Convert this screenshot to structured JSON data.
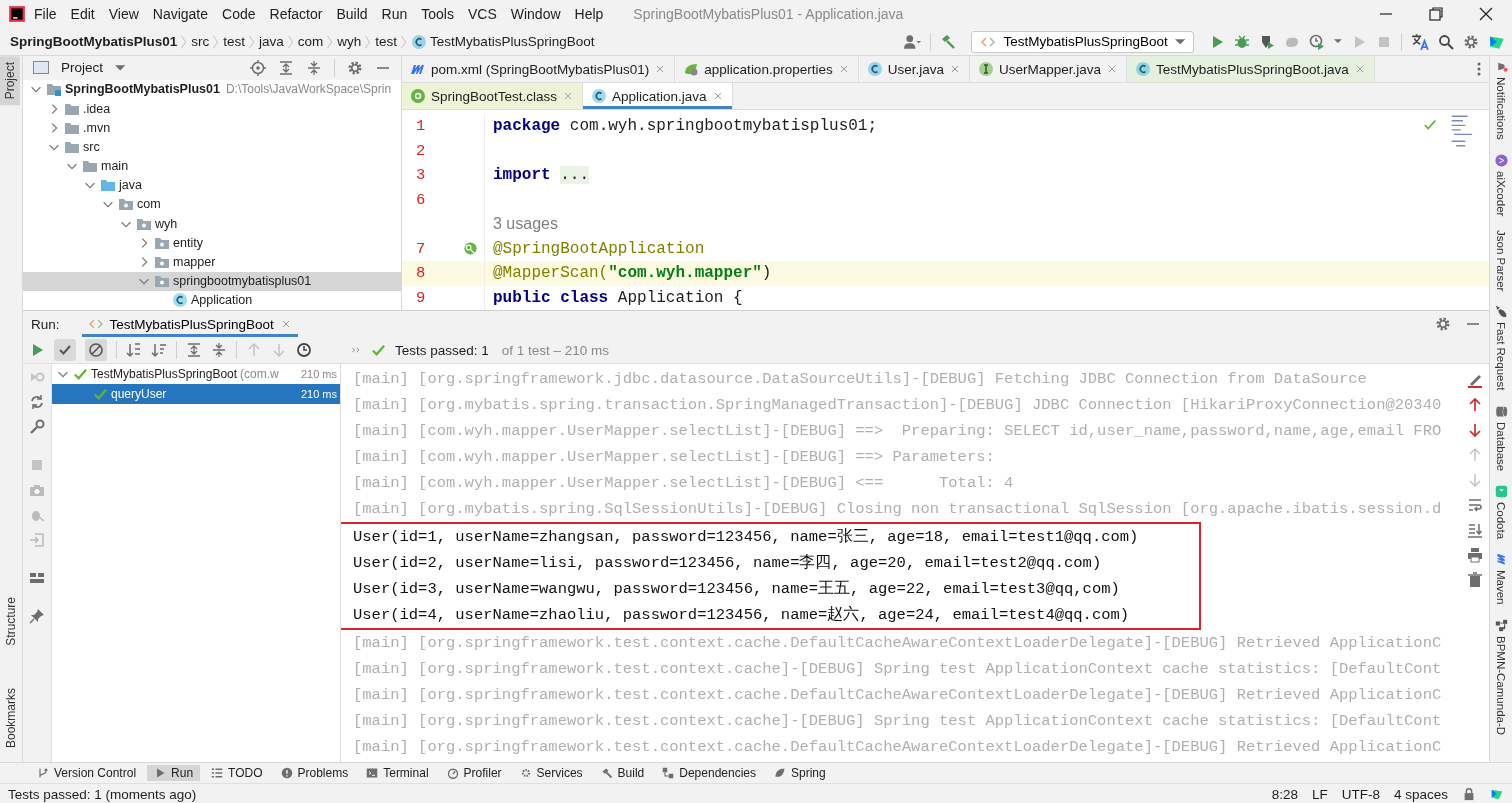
{
  "menu_bar": {
    "items": [
      "File",
      "Edit",
      "View",
      "Navigate",
      "Code",
      "Refactor",
      "Build",
      "Run",
      "Tools",
      "VCS",
      "Window",
      "Help"
    ],
    "title": "SpringBootMybatisPlus01 - Application.java"
  },
  "nav_bar": {
    "breadcrumbs": [
      {
        "label": "SpringBootMybatisPlus01",
        "kind": "project"
      },
      {
        "label": "src",
        "kind": "dir"
      },
      {
        "label": "test",
        "kind": "dir"
      },
      {
        "label": "java",
        "kind": "dir"
      },
      {
        "label": "com",
        "kind": "dir"
      },
      {
        "label": "wyh",
        "kind": "dir"
      },
      {
        "label": "test",
        "kind": "dir"
      },
      {
        "label": "TestMybatisPlusSpringBoot",
        "kind": "class"
      }
    ],
    "run_config": "TestMybatisPlusSpringBoot"
  },
  "left_strip": {
    "top": [
      {
        "label": "Project",
        "selected": true
      }
    ],
    "bottom": [
      {
        "label": "Structure",
        "selected": false
      },
      {
        "label": "Bookmarks",
        "selected": false
      }
    ]
  },
  "project_panel": {
    "title": "Project",
    "tree": [
      {
        "label": "SpringBootMybatisPlus01",
        "path": "D:\\Tools\\JavaWorkSpace\\Sprin",
        "kind": "module",
        "expanded": true,
        "selected": false,
        "children": [
          {
            "label": ".idea",
            "kind": "folder",
            "expanded": false,
            "selected": false
          },
          {
            "label": ".mvn",
            "kind": "folder",
            "expanded": false,
            "selected": false
          },
          {
            "label": "src",
            "kind": "folder",
            "expanded": true,
            "selected": false,
            "children": [
              {
                "label": "main",
                "kind": "folder",
                "expanded": true,
                "selected": false,
                "children": [
                  {
                    "label": "java",
                    "kind": "source",
                    "expanded": true,
                    "selected": false,
                    "children": [
                      {
                        "label": "com",
                        "kind": "package",
                        "expanded": true,
                        "selected": false,
                        "children": [
                          {
                            "label": "wyh",
                            "kind": "package",
                            "expanded": true,
                            "selected": false,
                            "children": [
                              {
                                "label": "entity",
                                "kind": "package",
                                "expanded": false,
                                "selected": false
                              },
                              {
                                "label": "mapper",
                                "kind": "package",
                                "expanded": false,
                                "selected": false
                              },
                              {
                                "label": "springbootmybatisplus01",
                                "kind": "package",
                                "expanded": true,
                                "selected": true,
                                "children": [
                                  {
                                    "label": "Application",
                                    "kind": "file",
                                    "selected": false
                                  }
                                ]
                              }
                            ]
                          }
                        ]
                      }
                    ]
                  }
                ]
              }
            ]
          }
        ]
      }
    ]
  },
  "editor": {
    "tab_rows": [
      [
        {
          "label": "pom.xml (SpringBootMybatisPlus01)",
          "kind": "maven",
          "selected": false
        },
        {
          "label": "application.properties",
          "kind": "properties",
          "selected": false
        },
        {
          "label": "User.java",
          "kind": "class",
          "selected": false
        },
        {
          "label": "UserMapper.java",
          "kind": "interface",
          "selected": false
        },
        {
          "label": "TestMybatisPlusSpringBoot.java",
          "kind": "test",
          "selected": false
        }
      ],
      [
        {
          "label": "SpringBootTest.class",
          "kind": "library",
          "selected": false
        },
        {
          "label": "Application.java",
          "kind": "class",
          "selected": true
        }
      ]
    ],
    "lines": [
      {
        "number": "1",
        "current": false,
        "segments": [
          {
            "text": "package",
            "kind": "keyword"
          },
          {
            "text": " com.wyh.springbootmybatisplus01;",
            "kind": "plain"
          }
        ]
      },
      {
        "number": "2",
        "current": false
      },
      {
        "number": "3",
        "current": false,
        "segments": [
          {
            "text": "import",
            "kind": "keyword"
          },
          {
            "text": "...",
            "kind": "folded"
          }
        ]
      },
      {
        "number": "6",
        "current": false
      },
      {
        "current": false,
        "segments": [
          {
            "text": "3 usages",
            "kind": "hint"
          }
        ]
      },
      {
        "number": "7",
        "current": false,
        "segments": [
          {
            "text": "@SpringBootApplication",
            "kind": "annotation"
          }
        ]
      },
      {
        "number": "8",
        "current": true,
        "segments": [
          {
            "text": "@MapperScan(",
            "kind": "annotation"
          },
          {
            "text": "\"com.wyh.mapper\"",
            "kind": "string"
          },
          {
            "text": ")",
            "kind": "plain"
          }
        ]
      },
      {
        "number": "9",
        "current": false,
        "segments": [
          {
            "text": "public class",
            "kind": "keyword"
          },
          {
            "text": " Application {",
            "kind": "plain"
          }
        ]
      }
    ]
  },
  "right_strip": {
    "tabs": [
      {
        "label": "Notifications",
        "kind": "bell"
      },
      {
        "label": "aiXcoder",
        "kind": "ax"
      },
      {
        "label": "Json Parser",
        "kind": "none"
      },
      {
        "label": "Fast Request",
        "kind": "rocket"
      },
      {
        "label": "Database",
        "kind": "db"
      },
      {
        "label": "Codota",
        "kind": "codota"
      },
      {
        "label": "Maven",
        "kind": "maven"
      },
      {
        "label": "BPMN-Camunda-D",
        "kind": "bpmn"
      }
    ]
  },
  "run_panel": {
    "label": "Run:",
    "tab": "TestMybatisPlusSpringBoot",
    "status": "Tests passed: 1",
    "status_detail": "of 1 test – 210 ms",
    "test_tree": [
      {
        "label": "TestMybatisPlusSpringBoot",
        "hint": "(com.w",
        "duration": "210 ms",
        "expanded": true,
        "selected": false,
        "children": [
          {
            "label": "queryUser",
            "duration": "210 ms",
            "selected": true
          }
        ]
      }
    ],
    "console": [
      {
        "kind": "log",
        "text": "[main] [org.springframework.jdbc.datasource.DataSourceUtils]-[DEBUG] Fetching JDBC Connection from DataSource"
      },
      {
        "kind": "log",
        "text": "[main] [org.mybatis.spring.transaction.SpringManagedTransaction]-[DEBUG] JDBC Connection [HikariProxyConnection@20340"
      },
      {
        "kind": "log",
        "text": "[main] [com.wyh.mapper.UserMapper.selectList]-[DEBUG] ==>  Preparing: SELECT id,user_name,password,name,age,email FRO"
      },
      {
        "kind": "log",
        "text": "[main] [com.wyh.mapper.UserMapper.selectList]-[DEBUG] ==> Parameters:"
      },
      {
        "kind": "log",
        "text": "[main] [com.wyh.mapper.UserMapper.selectList]-[DEBUG] <==      Total: 4"
      },
      {
        "kind": "log",
        "text": "[main] [org.mybatis.spring.SqlSessionUtils]-[DEBUG] Closing non transactional SqlSession [org.apache.ibatis.session.d"
      },
      {
        "kind": "output",
        "text": "User(id=1, userName=zhangsan, password=123456, name=张三, age=18, email=test1@qq.com)"
      },
      {
        "kind": "output",
        "text": "User(id=2, userName=lisi, password=123456, name=李四, age=20, email=test2@qq.com)"
      },
      {
        "kind": "output",
        "text": "User(id=3, userName=wangwu, password=123456, name=王五, age=22, email=test3@qq,com)"
      },
      {
        "kind": "output",
        "text": "User(id=4, userName=zhaoliu, password=123456, name=赵六, age=24, email=test4@qq.com)"
      },
      {
        "kind": "log",
        "text": "[main] [org.springframework.test.context.cache.DefaultCacheAwareContextLoaderDelegate]-[DEBUG] Retrieved ApplicationC"
      },
      {
        "kind": "log",
        "text": "[main] [org.springframework.test.context.cache]-[DEBUG] Spring test ApplicationContext cache statistics: [DefaultCont"
      },
      {
        "kind": "log",
        "text": "[main] [org.springframework.test.context.cache.DefaultCacheAwareContextLoaderDelegate]-[DEBUG] Retrieved ApplicationC"
      },
      {
        "kind": "log",
        "text": "[main] [org.springframework.test.context.cache]-[DEBUG] Spring test ApplicationContext cache statistics: [DefaultCont"
      },
      {
        "kind": "log",
        "text": "[main] [org.springframework.test.context.cache.DefaultCacheAwareContextLoaderDelegate]-[DEBUG] Retrieved ApplicationC"
      }
    ]
  },
  "tool_windows": [
    {
      "label": "Version Control",
      "kind": "vcs",
      "selected": false
    },
    {
      "label": "Run",
      "kind": "run",
      "selected": true
    },
    {
      "label": "TODO",
      "kind": "list",
      "selected": false
    },
    {
      "label": "Problems",
      "kind": "problems",
      "selected": false
    },
    {
      "label": "Terminal",
      "kind": "terminal",
      "selected": false
    },
    {
      "label": "Profiler",
      "kind": "profiler",
      "selected": false
    },
    {
      "label": "Services",
      "kind": "services",
      "selected": false
    },
    {
      "label": "Build",
      "kind": "build",
      "selected": false
    },
    {
      "label": "Dependencies",
      "kind": "deps",
      "selected": false
    },
    {
      "label": "Spring",
      "kind": "spring",
      "selected": false
    }
  ],
  "status_bar": {
    "message": "Tests passed: 1 (moments ago)",
    "items": [
      "8:28",
      "LF",
      "UTF-8",
      "4 spaces"
    ]
  }
}
